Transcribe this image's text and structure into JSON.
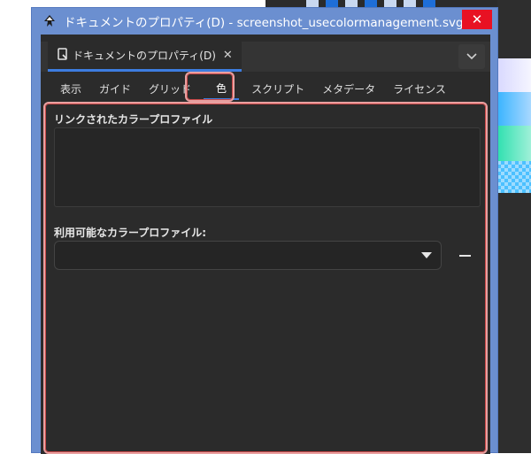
{
  "window": {
    "title": "ドキュメントのプロパティ(D) - screenshot_usecolormanagement.svg",
    "close_glyph": "✕"
  },
  "dock": {
    "tab_label": "ドキュメントのプロパティ(D)",
    "tab_close_glyph": "✕"
  },
  "tabs": [
    {
      "label": "表示"
    },
    {
      "label": "ガイド"
    },
    {
      "label": "グリッド"
    },
    {
      "label": "色"
    },
    {
      "label": "スクリプト"
    },
    {
      "label": "メタデータ"
    },
    {
      "label": "ライセンス"
    }
  ],
  "active_tab": "色",
  "color_panel": {
    "linked_profiles_label": "リンクされたカラープロファイル",
    "available_profiles_label": "利用可能なカラープロファイル:",
    "available_profiles_value": ""
  },
  "colors": {
    "titlebar": "#6b8fd0",
    "panel_bg": "#2b2b2b",
    "accent": "#3d7de0",
    "highlight": "#e8a0a0",
    "close": "#e81123"
  }
}
